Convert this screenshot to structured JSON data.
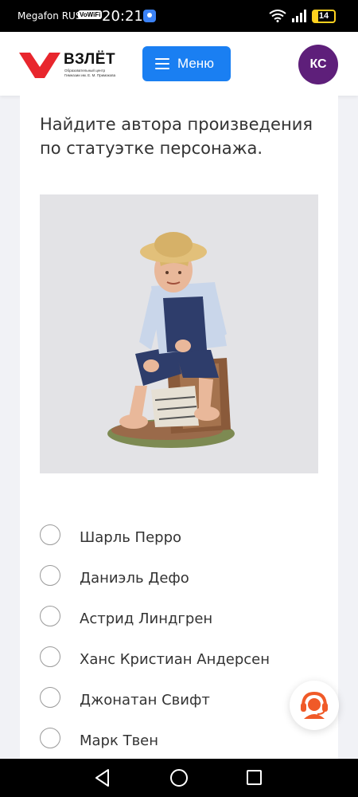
{
  "status_bar": {
    "carrier": "Megafon RUS",
    "volte": "VoWiFi",
    "time": "20:21",
    "battery": "14"
  },
  "header": {
    "logo_title": "ВЗЛЁТ",
    "logo_subtitle": "Образовательный центр Гимназии им. Е. М. Примакова",
    "menu_label": "Меню",
    "avatar_initials": "КС"
  },
  "question": {
    "text": "Найдите автора произведения по статуэтке персонажа."
  },
  "options": [
    {
      "label": "Шарль Перро",
      "selected": false
    },
    {
      "label": "Даниэль Дефо",
      "selected": false
    },
    {
      "label": "Астрид Линдгрен",
      "selected": false
    },
    {
      "label": "Ханс Кристиан Андерсен",
      "selected": false
    },
    {
      "label": "Джонатан Свифт",
      "selected": false
    },
    {
      "label": "Марк Твен",
      "selected": false
    }
  ],
  "colors": {
    "accent": "#1a7ff2",
    "avatar": "#5e1f7a",
    "logo_red": "#e8262d",
    "support": "#f05a28"
  },
  "icons": [
    "location-icon",
    "wifi-icon",
    "signal-icon",
    "battery-icon",
    "menu-icon",
    "headset-icon",
    "back-icon",
    "home-icon",
    "recents-icon"
  ]
}
